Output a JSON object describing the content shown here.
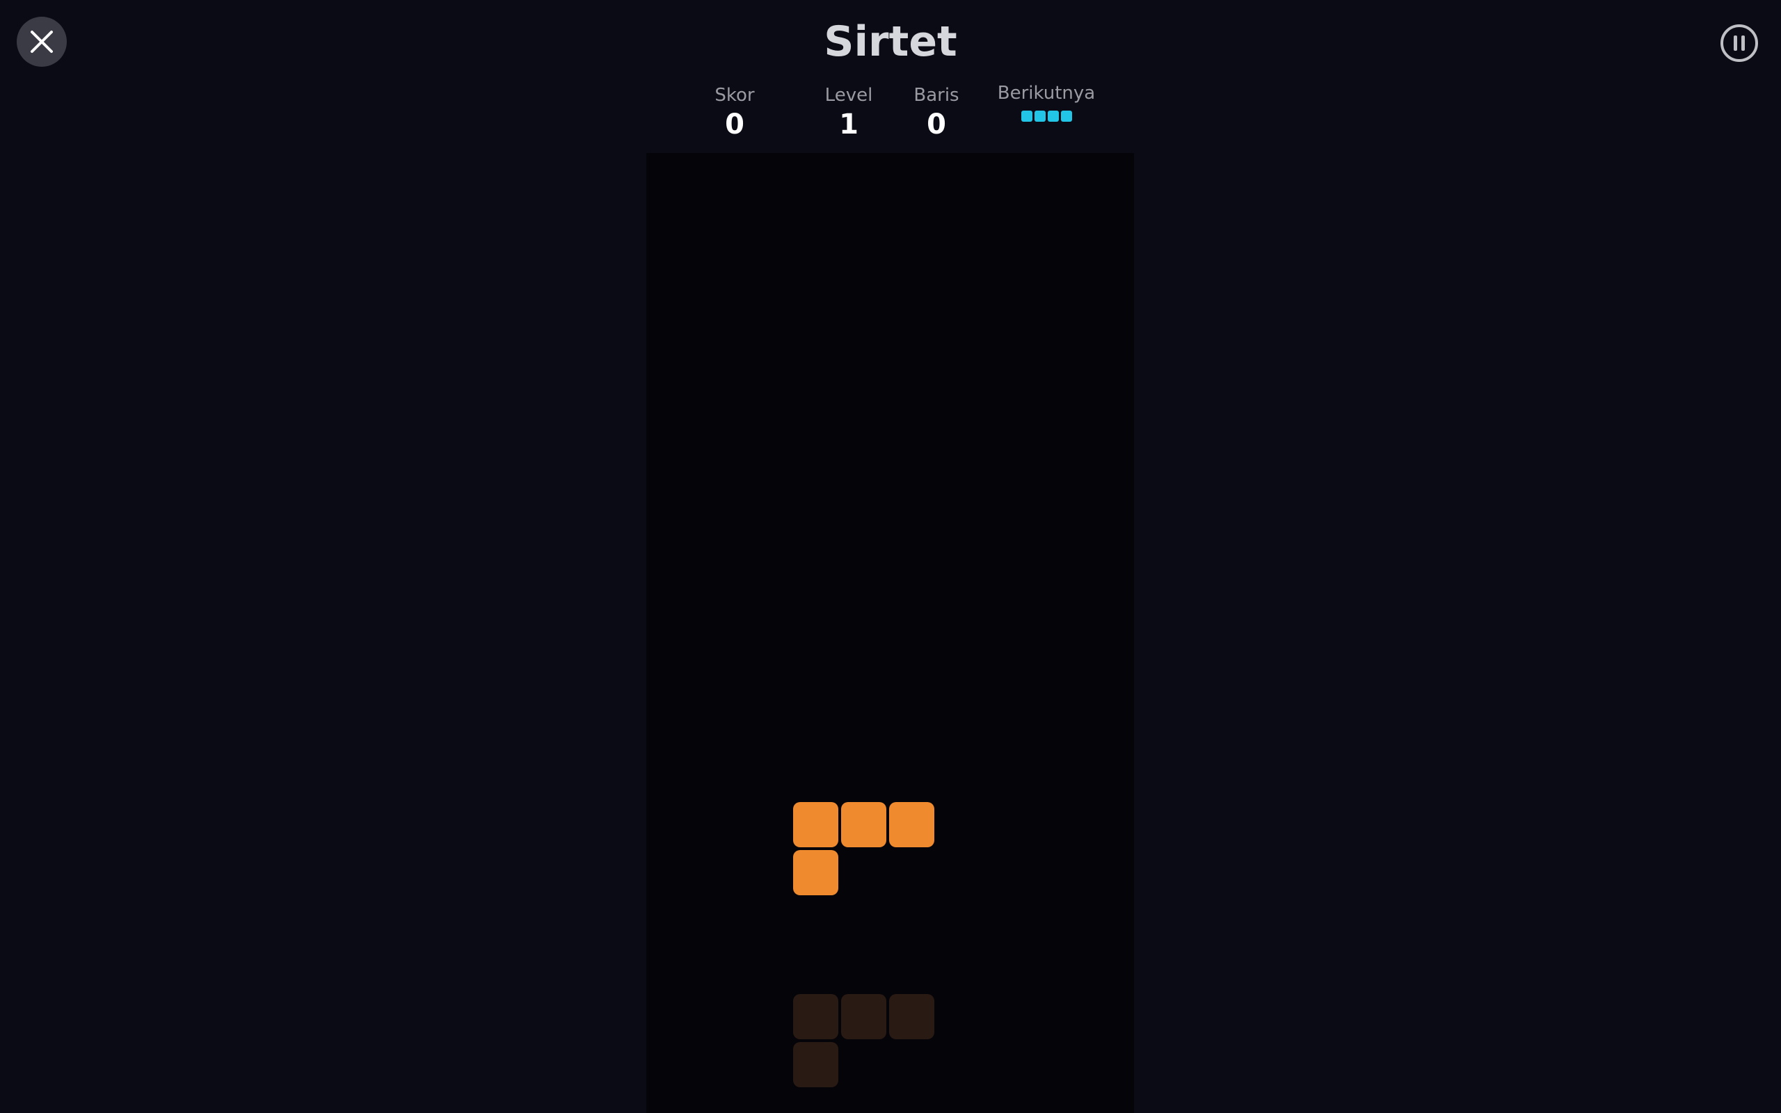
{
  "game": {
    "title": "Sirtet"
  },
  "controls": {
    "close_icon": "close-icon",
    "pause_icon": "pause-icon"
  },
  "stats": {
    "score_label": "Skor",
    "score_value": "0",
    "level_label": "Level",
    "level_value": "1",
    "lines_label": "Baris",
    "lines_value": "0",
    "next_label": "Berikutnya"
  },
  "next_piece": {
    "type": "I",
    "color": "#22c5e6",
    "cells": [
      [
        0,
        0
      ],
      [
        1,
        0
      ],
      [
        2,
        0
      ],
      [
        3,
        0
      ]
    ]
  },
  "board": {
    "columns": 10,
    "rows": 20,
    "background": "#040409",
    "active_piece": {
      "type": "L",
      "color": "#ef8a2e",
      "cells": [
        [
          3,
          14
        ],
        [
          4,
          14
        ],
        [
          5,
          14
        ],
        [
          3,
          15
        ]
      ]
    },
    "ghost_piece": {
      "type": "L",
      "color": "#2a1a14",
      "cells": [
        [
          3,
          18
        ],
        [
          4,
          18
        ],
        [
          5,
          18
        ],
        [
          3,
          19
        ]
      ]
    }
  },
  "colors": {
    "background": "#0a0b14",
    "close_button": "#3a3b44",
    "pause_icon": "#bfc0c5"
  }
}
